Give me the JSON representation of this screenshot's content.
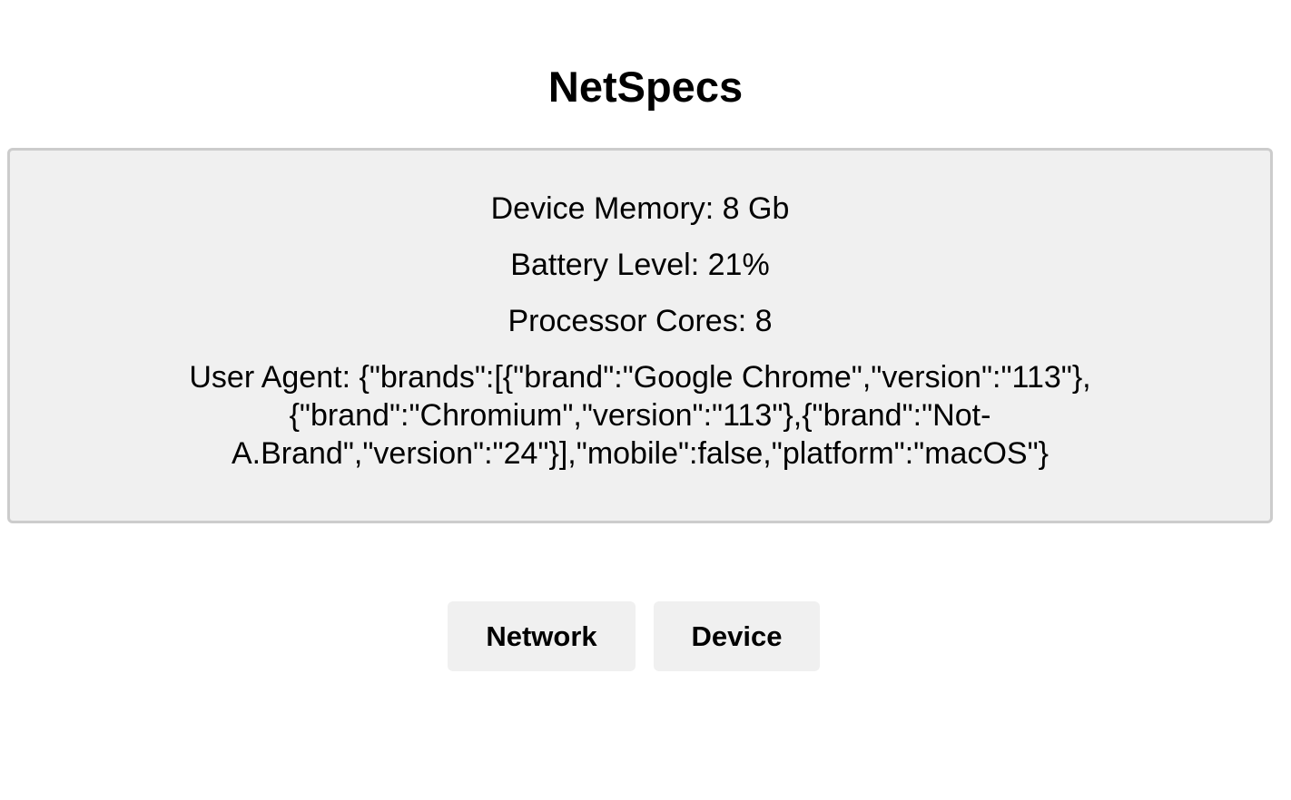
{
  "app": {
    "title": "NetSpecs"
  },
  "device_info": {
    "memory": "Device Memory: 8 Gb",
    "battery": "Battery Level: 21%",
    "cores": "Processor Cores: 8",
    "user_agent_lines": [
      "User Agent: {\"brands\":[{\"brand\":\"Google Chrome\",\"version\":\"113\"},",
      "{\"brand\":\"Chromium\",\"version\":\"113\"},{\"brand\":\"Not-",
      "A.Brand\",\"version\":\"24\"}],\"mobile\":false,\"platform\":\"macOS\"}"
    ]
  },
  "nav": {
    "network_label": "Network",
    "device_label": "Device"
  },
  "colors": {
    "panel_background": "#f0f0f0",
    "panel_border": "#cccccc",
    "button_background": "#f0f0f0",
    "text": "#000000"
  }
}
